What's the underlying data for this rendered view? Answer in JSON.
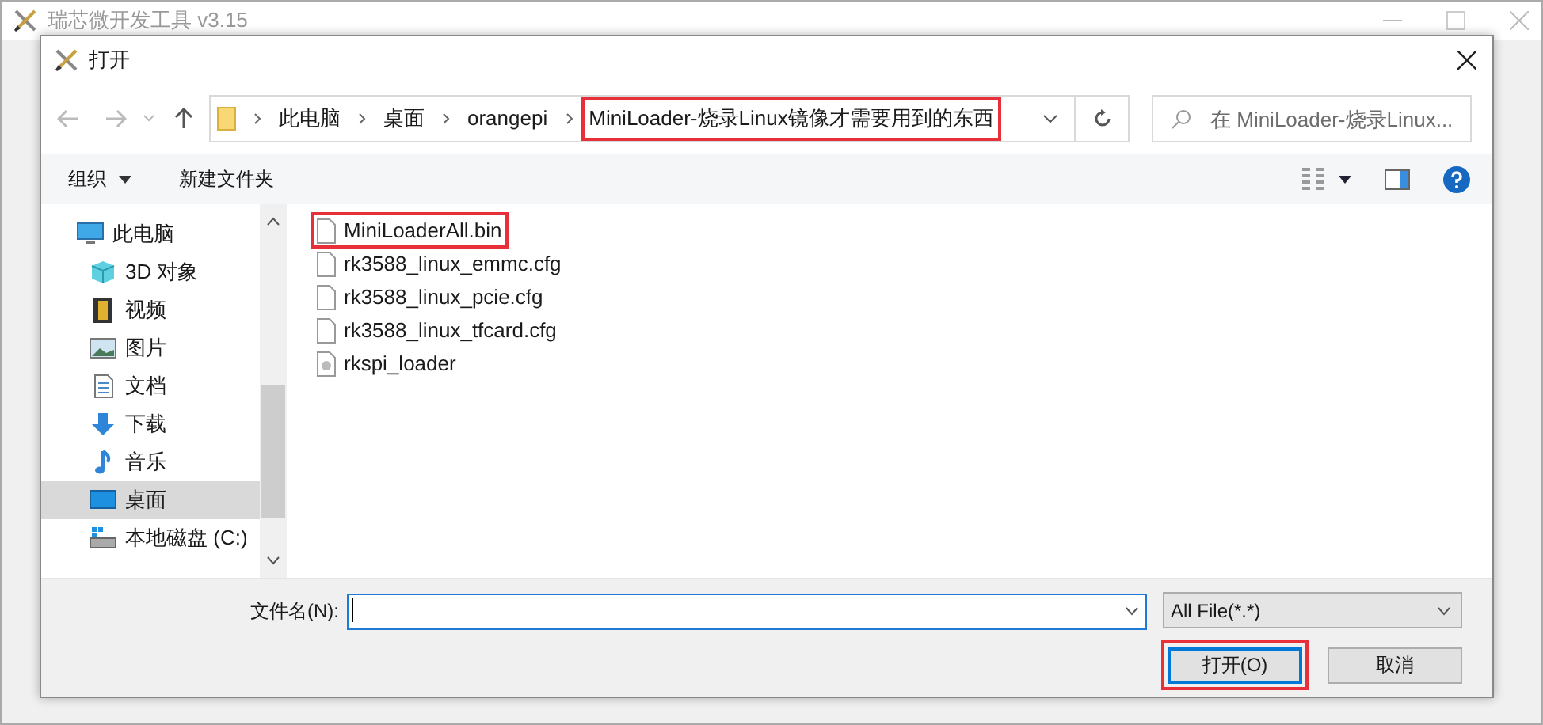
{
  "app_window": {
    "title": "瑞芯微开发工具 v3.15"
  },
  "dialog": {
    "title": "打开",
    "breadcrumb": [
      {
        "label": "此电脑",
        "highlighted": false
      },
      {
        "label": "桌面",
        "highlighted": false
      },
      {
        "label": "orangepi",
        "highlighted": false
      },
      {
        "label": "MiniLoader-烧录Linux镜像才需要用到的东西",
        "highlighted": true
      }
    ],
    "search": {
      "placeholder": "在 MiniLoader-烧录Linux..."
    },
    "toolbar": {
      "organize": "组织",
      "new_folder": "新建文件夹"
    },
    "sidebar": [
      {
        "label": "此电脑",
        "kind": "computer",
        "selected": false,
        "children": [
          {
            "label": "3D 对象",
            "kind": "cube",
            "selected": false
          },
          {
            "label": "视频",
            "kind": "film",
            "selected": false
          },
          {
            "label": "图片",
            "kind": "picture",
            "selected": false
          },
          {
            "label": "文档",
            "kind": "document",
            "selected": false
          },
          {
            "label": "下载",
            "kind": "download",
            "selected": false
          },
          {
            "label": "音乐",
            "kind": "music",
            "selected": false
          },
          {
            "label": "桌面",
            "kind": "desktop",
            "selected": true
          },
          {
            "label": "本地磁盘 (C:)",
            "kind": "disk",
            "selected": false
          }
        ]
      }
    ],
    "files": [
      {
        "name": "MiniLoaderAll.bin",
        "kind": "file",
        "highlighted": true
      },
      {
        "name": "rk3588_linux_emmc.cfg",
        "kind": "file",
        "highlighted": false
      },
      {
        "name": "rk3588_linux_pcie.cfg",
        "kind": "file",
        "highlighted": false
      },
      {
        "name": "rk3588_linux_tfcard.cfg",
        "kind": "file",
        "highlighted": false
      },
      {
        "name": "rkspi_loader",
        "kind": "system",
        "highlighted": false
      }
    ],
    "file_name": {
      "label": "文件名(N):"
    },
    "file_type": {
      "value": "All File(*.*)"
    },
    "buttons": [
      {
        "label": "打开(O)",
        "default": true,
        "highlighted": true
      },
      {
        "label": "取消",
        "default": false,
        "highlighted": false
      }
    ]
  }
}
